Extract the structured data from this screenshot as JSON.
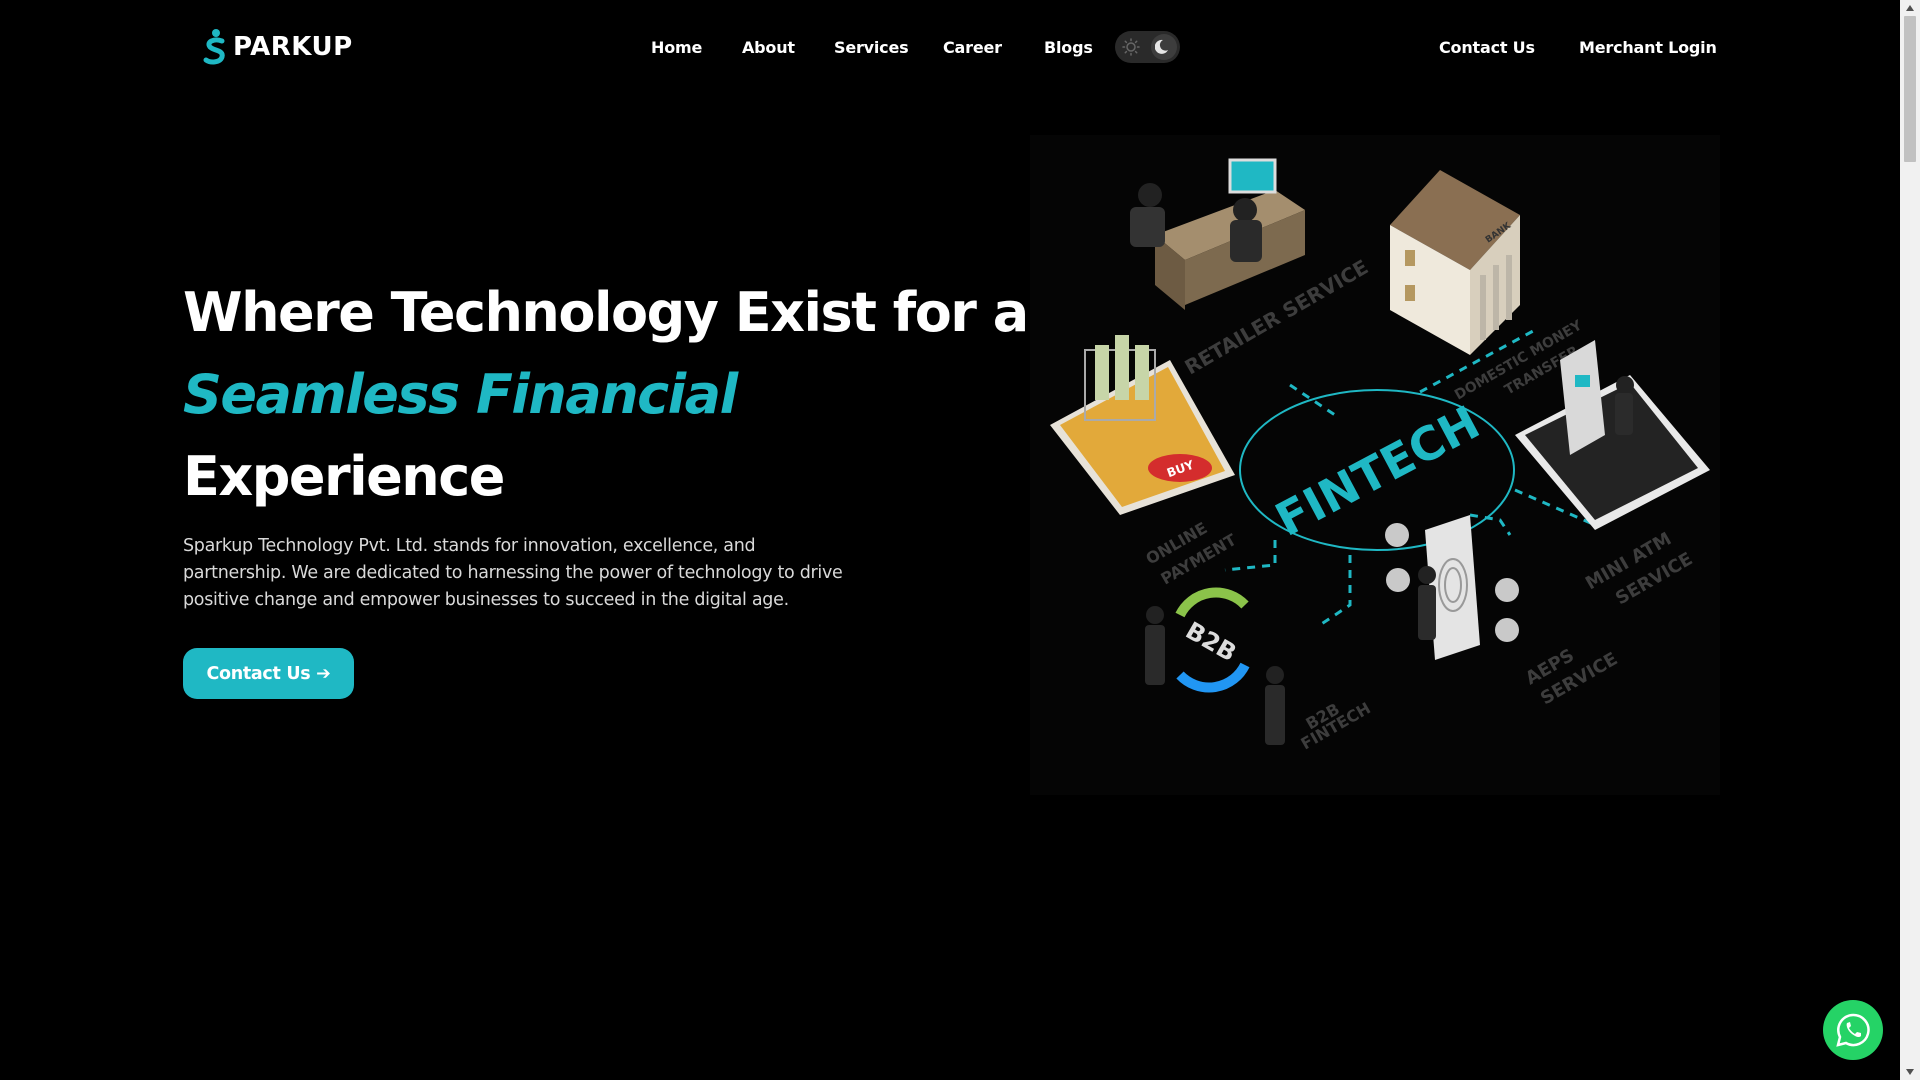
{
  "header": {
    "logo_text": "PARKUP",
    "nav": [
      {
        "label": "Home"
      },
      {
        "label": "About"
      },
      {
        "label": "Services"
      },
      {
        "label": "Career"
      },
      {
        "label": "Blogs"
      }
    ],
    "theme_toggle": {
      "light_icon": "sun-icon",
      "dark_icon": "moon-icon",
      "active": "dark"
    },
    "contact_label": "Contact Us",
    "merchant_label": "Merchant Login"
  },
  "hero": {
    "title_line1": "Where Technology Exist for a",
    "title_line2": "Seamless Financial",
    "title_line3": "Experience",
    "description": "Sparkup Technology Pvt. Ltd. stands for innovation, excellence, and partnership. We are dedicated to harnessing the power of technology to drive positive change and empower businesses to succeed in the digital age.",
    "cta_label": "Contact Us ➔"
  },
  "illustration": {
    "center_label": "FINTECH",
    "labels": {
      "retailer": "RETAILER SERVICE",
      "domestic_1": "DOMESTIC MONEY",
      "domestic_2": "TRANSFER",
      "online_1": "ONLINE",
      "online_2": "PAYMENT",
      "mini_atm_1": "MINI ATM",
      "mini_atm_2": "SERVICE",
      "aeps_1": "AEPS",
      "aeps_2": "SERVICE",
      "b2b_1": "B2B",
      "b2b_2": "FINTECH",
      "bank": "BANK",
      "buy": "BUY",
      "b2b_badge": "B2B"
    }
  },
  "colors": {
    "accent": "#1fb8c4",
    "background": "#000000",
    "whatsapp": "#25d366"
  }
}
